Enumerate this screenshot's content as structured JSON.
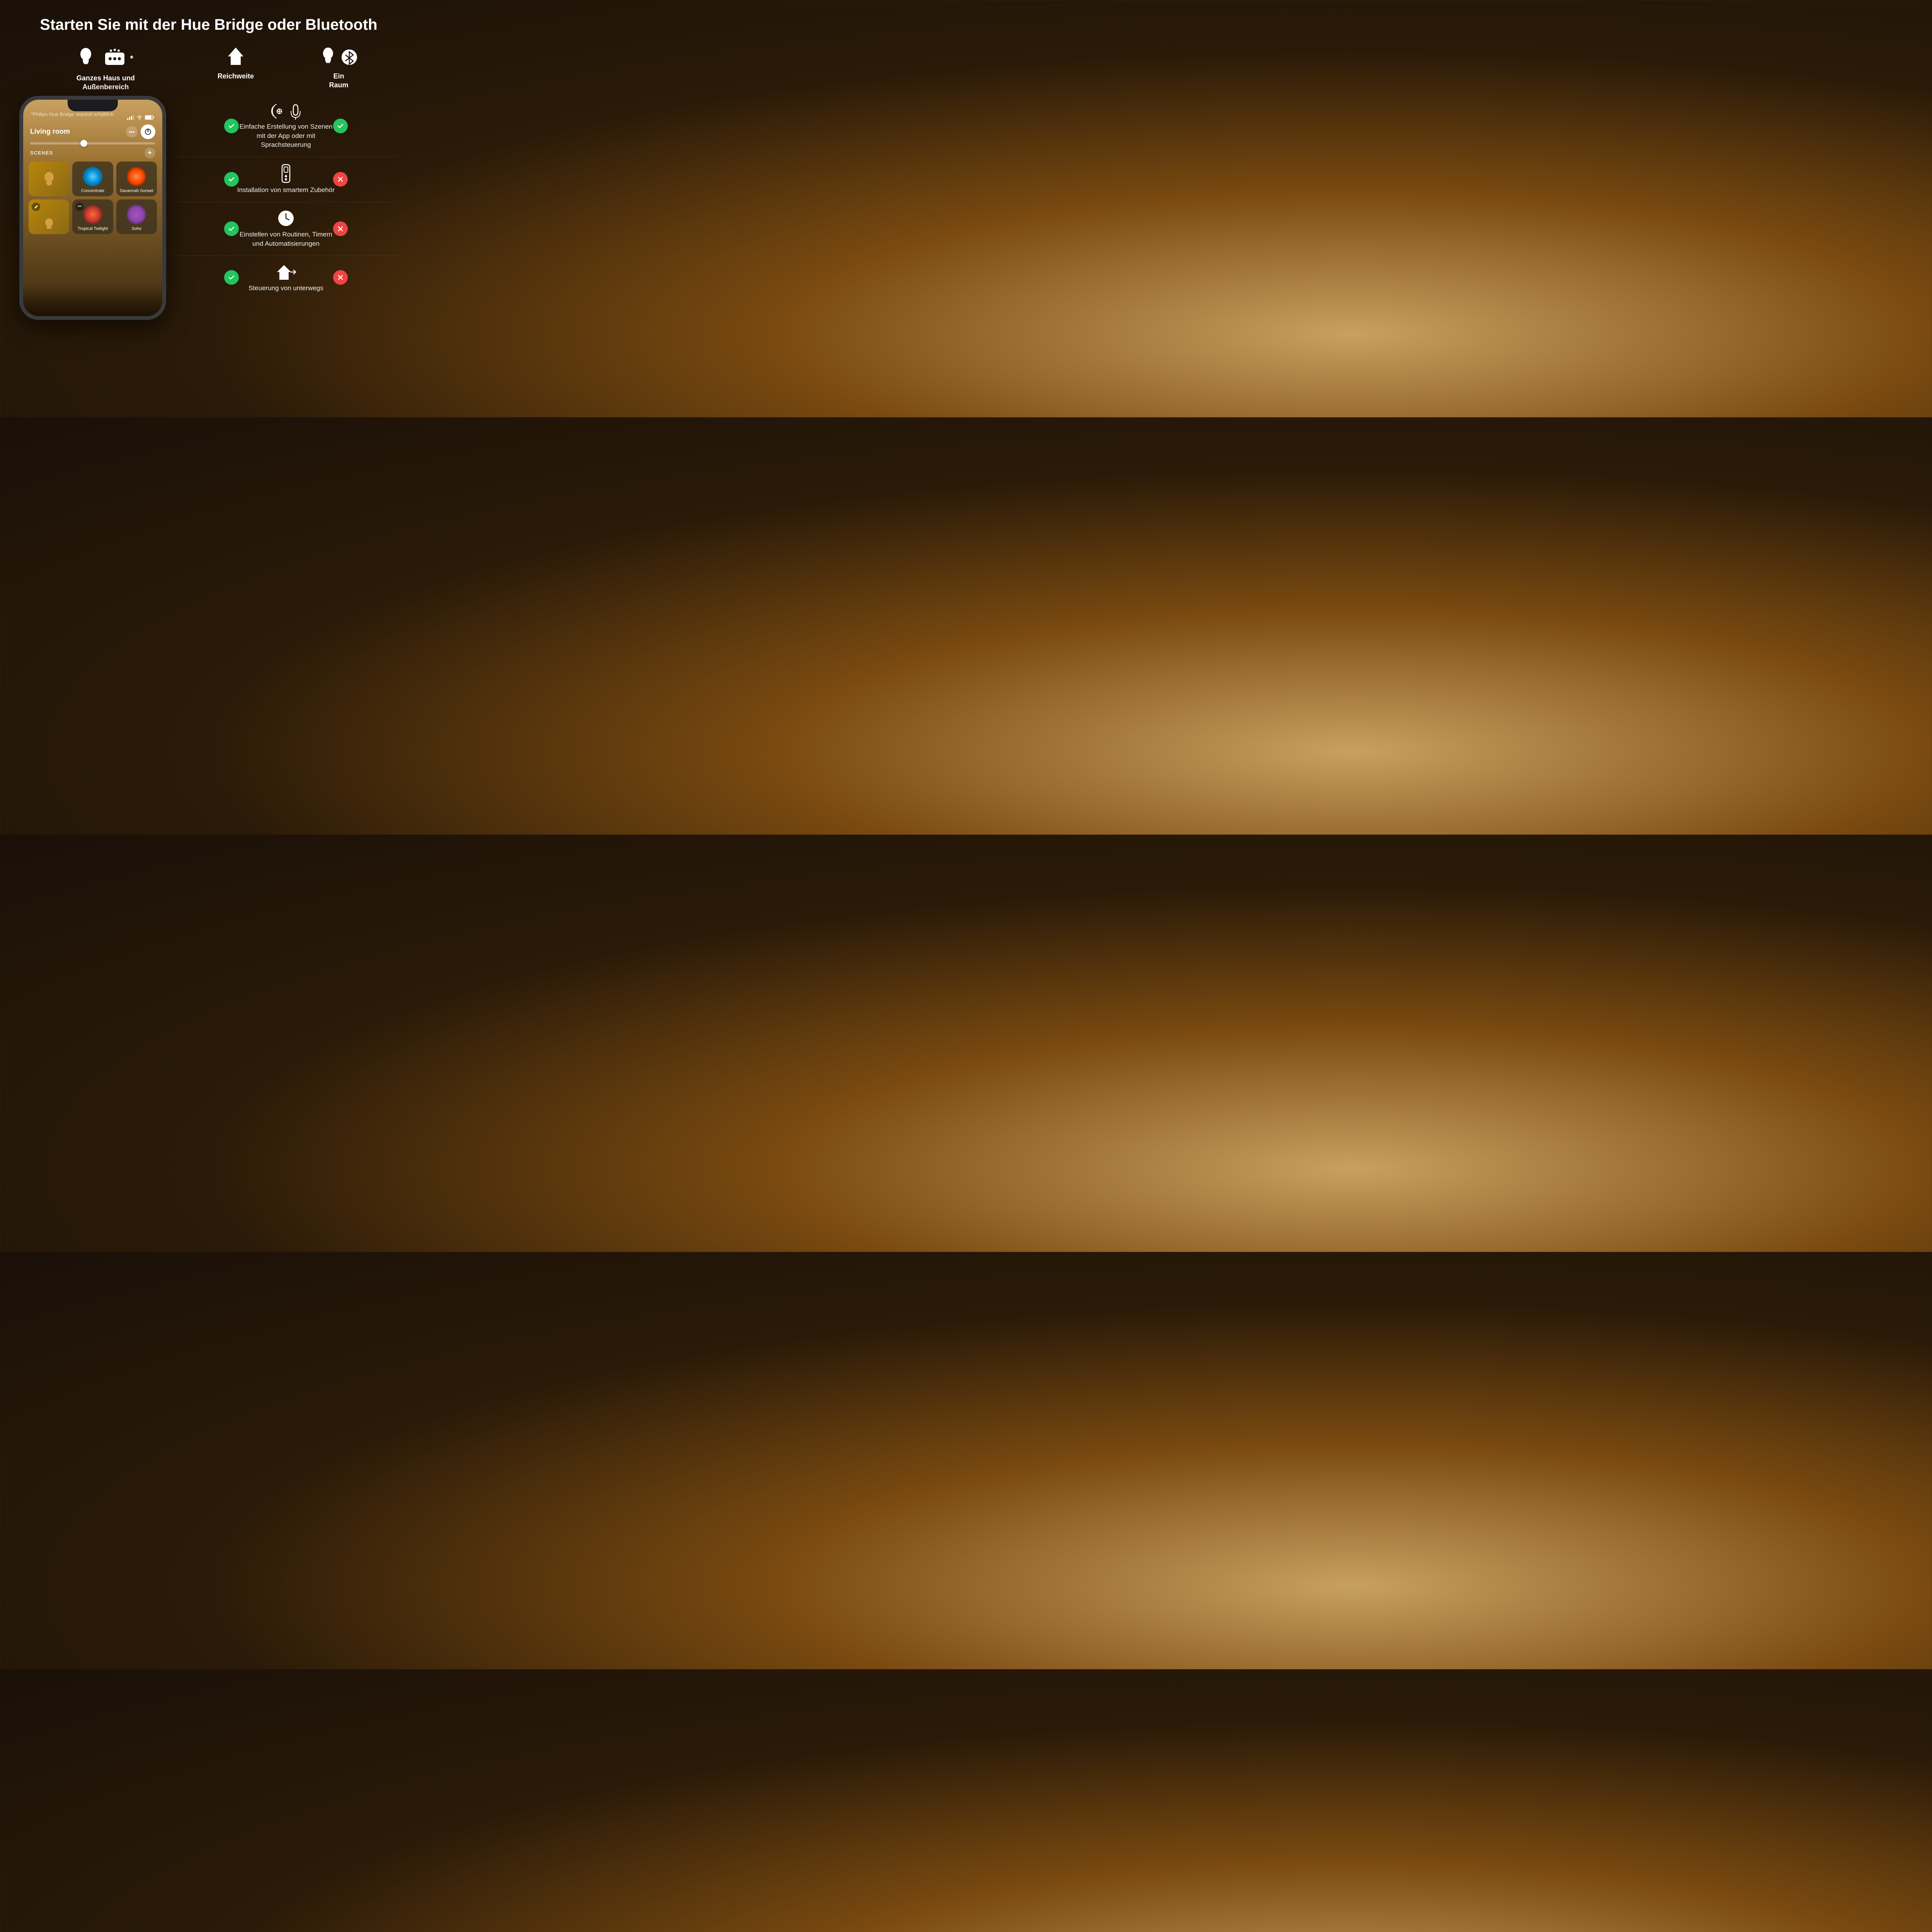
{
  "title": "Starten Sie mit der Hue Bridge oder Bluetooth",
  "bridge_label": "Ganzes Haus und\nAußenbereich",
  "range_label": "Reichweite",
  "bluetooth_label": "Ein\nRaum",
  "footnote": "*Philips Hue Bridge separat erhältlich",
  "features": [
    {
      "id": "voice",
      "text": "Einfache Erstellung von Szenen mit der App oder mit Sprachsteuerung",
      "bridge_check": true,
      "bluetooth_check": true
    },
    {
      "id": "accessories",
      "text": "Installation von smartem Zubehör",
      "bridge_check": true,
      "bluetooth_check": false
    },
    {
      "id": "routines",
      "text": "Einstellen von Routinen, Timern und Automatisierungen",
      "bridge_check": true,
      "bluetooth_check": false
    },
    {
      "id": "remote",
      "text": "Steuerung von unterwegs",
      "bridge_check": true,
      "bluetooth_check": false
    }
  ],
  "phone": {
    "room_name": "Living room",
    "scenes_label": "SCENES",
    "scenes": [
      {
        "name": "",
        "type": "warm",
        "row": 1
      },
      {
        "name": "Concentrate",
        "type": "concentrate",
        "row": 1
      },
      {
        "name": "Savannah\nSunset",
        "type": "savannah",
        "row": 1
      },
      {
        "name": "",
        "type": "warm2",
        "row": 2
      },
      {
        "name": "Tropical\nTwilight",
        "type": "tropical",
        "row": 2
      },
      {
        "name": "Soho",
        "type": "soho",
        "row": 2
      }
    ]
  }
}
